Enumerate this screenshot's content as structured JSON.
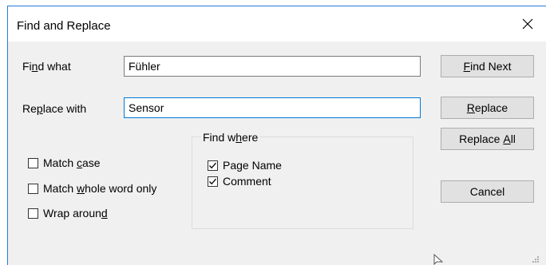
{
  "dialog": {
    "title": "Find and Replace",
    "close_glyph": "close-icon"
  },
  "find": {
    "label_pre": "Fi",
    "label_mnemonic": "n",
    "label_post": "d what",
    "value": "Fühler"
  },
  "replace": {
    "label_pre": "Re",
    "label_mnemonic": "p",
    "label_post": "lace with",
    "value": "Sensor"
  },
  "buttons": {
    "find_next": {
      "pre": "",
      "mnemonic": "F",
      "post": "ind Next"
    },
    "replace": {
      "pre": "",
      "mnemonic": "R",
      "post": "eplace"
    },
    "replace_all": {
      "pre": "Replace ",
      "mnemonic": "A",
      "post": "ll"
    },
    "cancel": {
      "label": "Cancel"
    }
  },
  "options": {
    "match_case": {
      "pre": "Match ",
      "mnemonic": "c",
      "post": "ase",
      "checked": false
    },
    "match_whole_word": {
      "pre": "Match ",
      "mnemonic": "w",
      "post": "hole word only",
      "checked": false
    },
    "wrap_around": {
      "pre": "Wrap aroun",
      "mnemonic": "d",
      "post": "",
      "checked": false
    }
  },
  "find_where": {
    "legend_pre": "Find w",
    "legend_mnemonic": "h",
    "legend_post": "ere",
    "items": [
      {
        "label": "Page Name",
        "checked": true
      },
      {
        "label": "Comment",
        "checked": true
      }
    ]
  },
  "colors": {
    "accent": "#0078d7",
    "window_border": "#2b79d9",
    "dialog_bg": "#f0f0f0",
    "button_bg": "#e1e1e1"
  }
}
